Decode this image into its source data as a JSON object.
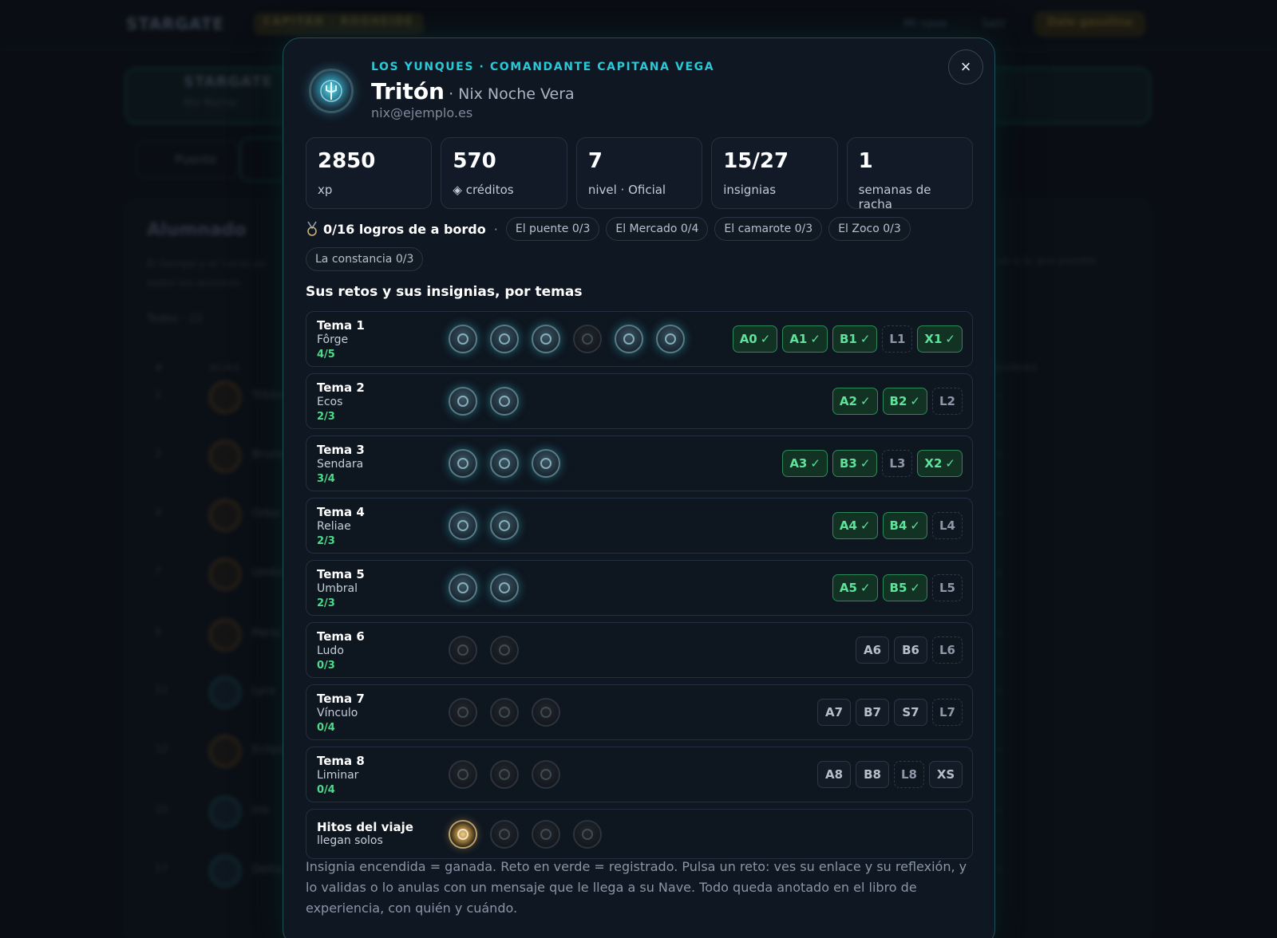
{
  "background": {
    "logo": "STARGATE",
    "badge": "CAPITÁN · ROGHEIDE",
    "nav_links": [
      "Mi nave",
      "Salir"
    ],
    "cta": "Dale gasolina",
    "card_title": "STARGATE",
    "card_sub": "Nix Noche",
    "tab_label": "Puente",
    "panel_title": "Alumnado",
    "panel_desc": "El tiempo y el curso de todos los alumnos",
    "panel_desc_right": "ve a lo que puedes",
    "filter": "Todos · 22",
    "col_headers": [
      "#",
      "ALIAS",
      "INSIGNIAS"
    ],
    "rows": [
      {
        "n": "1",
        "name": "Tritón",
        "teal": false
      },
      {
        "n": "2",
        "name": "Bruma",
        "teal": false
      },
      {
        "n": "4",
        "name": "Orbe",
        "teal": false
      },
      {
        "n": "7",
        "name": "Umbra",
        "teal": false
      },
      {
        "n": "9",
        "name": "Perla",
        "teal": false
      },
      {
        "n": "11",
        "name": "Lyra",
        "teal": true
      },
      {
        "n": "12",
        "name": "Eclipse",
        "teal": false
      },
      {
        "n": "15",
        "name": "Iris",
        "teal": true
      },
      {
        "n": "17",
        "name": "Delta",
        "teal": true
      }
    ]
  },
  "modal": {
    "crew_line": "LOS YUNQUES · COMANDANTE CAPITANA VEGA",
    "name": "Tritón",
    "subname": "· Nix Noche Vera",
    "email": "nix@ejemplo.es",
    "close_icon": "×",
    "stats": [
      {
        "value": "2850",
        "label": "xp"
      },
      {
        "value": "570",
        "label": "◈ créditos"
      },
      {
        "value": "7",
        "label": "nivel · Oficial"
      },
      {
        "value": "15/27",
        "label": "insignias"
      },
      {
        "value": "1",
        "label": "semanas de racha"
      }
    ],
    "achievements_title": "0/16 logros de a bordo",
    "achievement_chips": [
      "El puente 0/3",
      "El Mercado 0/4",
      "El camarote 0/3",
      "El Zoco 0/3",
      "La constancia 0/3"
    ],
    "section_title": "Sus retos y sus insignias, por temas",
    "topics": [
      {
        "title": "Tema 1",
        "sub": "Fôrge",
        "count": "4/5",
        "badges": [
          "on",
          "on",
          "on",
          "off",
          "on",
          "on"
        ],
        "challenges": [
          {
            "label": "A0",
            "state": "ok"
          },
          {
            "label": "A1",
            "state": "ok"
          },
          {
            "label": "B1",
            "state": "ok"
          },
          {
            "label": "L1",
            "state": "dash"
          },
          {
            "label": "X1",
            "state": "ok"
          }
        ]
      },
      {
        "title": "Tema 2",
        "sub": "Ecos",
        "count": "2/3",
        "badges": [
          "on",
          "on"
        ],
        "challenges": [
          {
            "label": "A2",
            "state": "ok"
          },
          {
            "label": "B2",
            "state": "ok"
          },
          {
            "label": "L2",
            "state": "dash"
          }
        ]
      },
      {
        "title": "Tema 3",
        "sub": "Sendara",
        "count": "3/4",
        "badges": [
          "on",
          "on",
          "on"
        ],
        "challenges": [
          {
            "label": "A3",
            "state": "ok"
          },
          {
            "label": "B3",
            "state": "ok"
          },
          {
            "label": "L3",
            "state": "dash"
          },
          {
            "label": "X2",
            "state": "ok"
          }
        ]
      },
      {
        "title": "Tema 4",
        "sub": "Reliae",
        "count": "2/3",
        "badges": [
          "on",
          "on"
        ],
        "challenges": [
          {
            "label": "A4",
            "state": "ok"
          },
          {
            "label": "B4",
            "state": "ok"
          },
          {
            "label": "L4",
            "state": "dash"
          }
        ]
      },
      {
        "title": "Tema 5",
        "sub": "Umbral",
        "count": "2/3",
        "badges": [
          "on",
          "on"
        ],
        "challenges": [
          {
            "label": "A5",
            "state": "ok"
          },
          {
            "label": "B5",
            "state": "ok"
          },
          {
            "label": "L5",
            "state": "dash"
          }
        ]
      },
      {
        "title": "Tema 6",
        "sub": "Ludo",
        "count": "0/3",
        "badges": [
          "off",
          "off"
        ],
        "challenges": [
          {
            "label": "A6",
            "state": "plain"
          },
          {
            "label": "B6",
            "state": "plain"
          },
          {
            "label": "L6",
            "state": "dash"
          }
        ]
      },
      {
        "title": "Tema 7",
        "sub": "Vínculo",
        "count": "0/4",
        "badges": [
          "off",
          "off",
          "off"
        ],
        "challenges": [
          {
            "label": "A7",
            "state": "plain"
          },
          {
            "label": "B7",
            "state": "plain"
          },
          {
            "label": "S7",
            "state": "plain"
          },
          {
            "label": "L7",
            "state": "dash"
          }
        ]
      },
      {
        "title": "Tema 8",
        "sub": "Liminar",
        "count": "0/4",
        "badges": [
          "off",
          "off",
          "off"
        ],
        "challenges": [
          {
            "label": "A8",
            "state": "plain"
          },
          {
            "label": "B8",
            "state": "plain"
          },
          {
            "label": "L8",
            "state": "dash"
          },
          {
            "label": "XS",
            "state": "plain"
          }
        ]
      },
      {
        "title": "Hitos del viaje",
        "sub": "llegan solos",
        "count": "",
        "badges": [
          "gold",
          "off",
          "off",
          "off"
        ],
        "challenges": []
      }
    ],
    "footnote": "Insignia encendida = ganada. Reto en verde = registrado. Pulsa un reto: ves su enlace y su reflexión, y lo validas o lo anulas con un mensaje que le llega a su Nave. Todo queda anotado en el libro de experiencia, con quién y cuándo."
  }
}
